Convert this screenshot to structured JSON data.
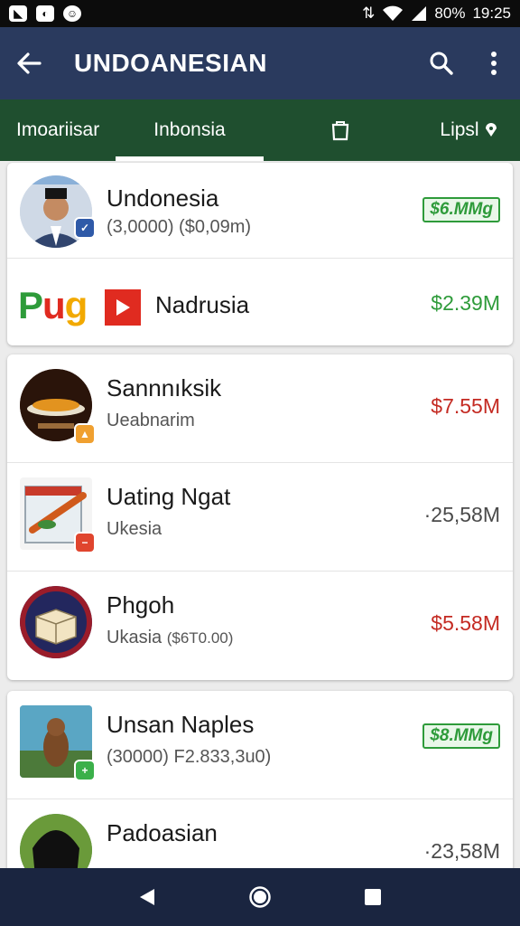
{
  "status_bar": {
    "battery": "80%",
    "time": "19:25"
  },
  "app_bar": {
    "title": "UNDOANESIAN"
  },
  "tabs": [
    {
      "label": "Imoariisar"
    },
    {
      "label": "Inbonsia",
      "selected": true
    },
    {
      "label": ""
    },
    {
      "label": "Lipsl"
    }
  ],
  "cards": [
    {
      "rows": [
        {
          "name": "Undonesia",
          "sub": "(3,0000) ($0,09m)",
          "amount": "$6.MMg",
          "amount_style": "pill"
        },
        {
          "logo_text": "Pug",
          "name": "Nadrusia",
          "amount": "$2.39M",
          "amount_style": "green"
        }
      ]
    },
    {
      "rows": [
        {
          "name": "Sannnıksik",
          "sub": "Ueabnarim",
          "amount": "$7.55M",
          "amount_style": "red"
        },
        {
          "name": "Uating Ngat",
          "sub": "Ukesia",
          "amount": "·25,58M",
          "amount_style": "gray"
        },
        {
          "name": "Phgoh",
          "sub": "Ukasia",
          "sub2": "($6T0.00)",
          "amount": "$5.58M",
          "amount_style": "red"
        }
      ]
    },
    {
      "rows": [
        {
          "name": "Unsan Naples",
          "sub": "(30000) F2.833,3u0)",
          "amount": "$8.MMg",
          "amount_style": "pill"
        },
        {
          "name": "Padoasian",
          "sub": "",
          "amount": "·23,58M",
          "amount_style": "gray"
        }
      ]
    }
  ],
  "colors": {
    "app_bar": "#2a3a5e",
    "tab_bar": "#1f4f2f",
    "nav_bar": "#1a2540",
    "positive": "#2e9b3a",
    "negative": "#c42a22"
  }
}
